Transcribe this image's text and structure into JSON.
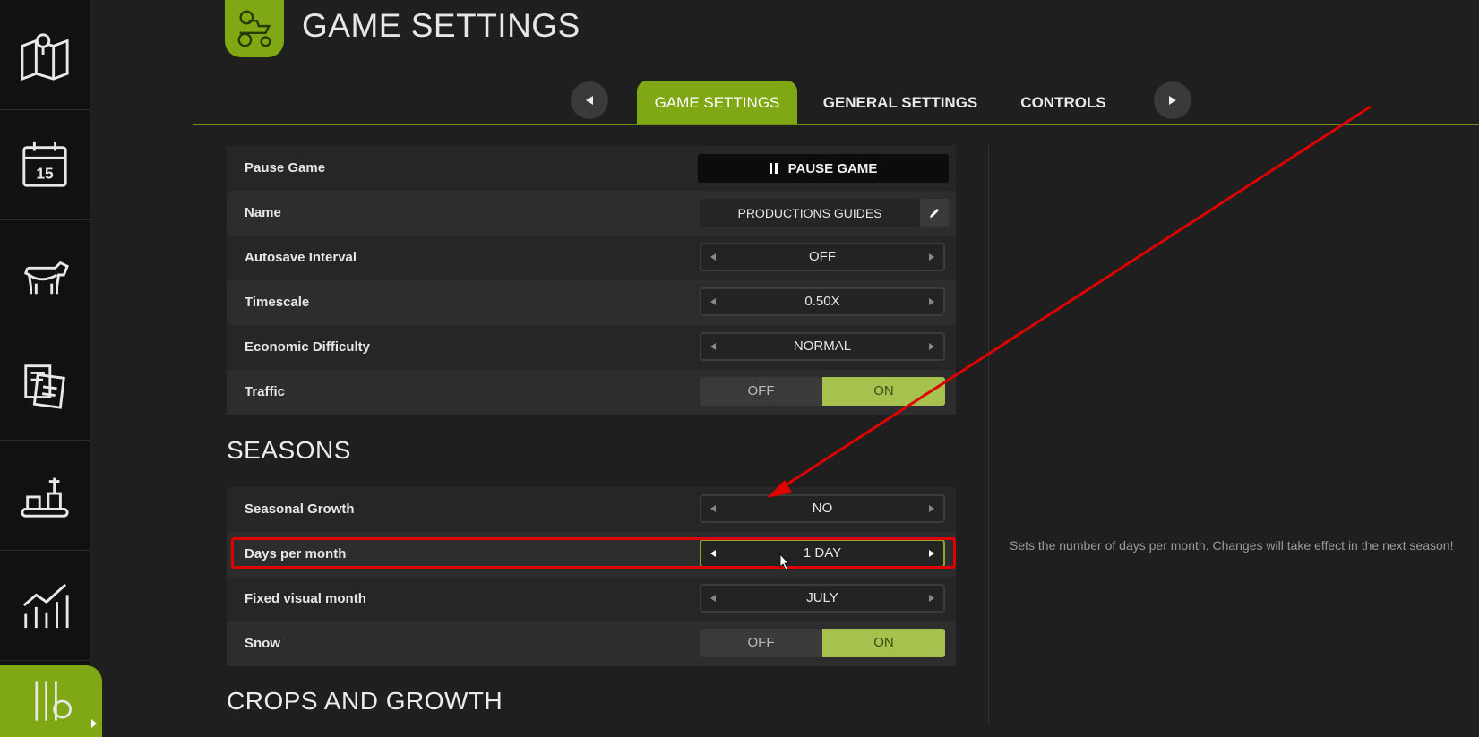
{
  "header": {
    "title": "GAME SETTINGS"
  },
  "tabs": [
    {
      "label": "GAME SETTINGS",
      "active": true
    },
    {
      "label": "GENERAL SETTINGS",
      "active": false
    },
    {
      "label": "CONTROLS",
      "active": false
    }
  ],
  "sidebar": {
    "items": [
      {
        "icon": "map-icon"
      },
      {
        "icon": "calendar-icon",
        "day": "15"
      },
      {
        "icon": "cow-icon"
      },
      {
        "icon": "contracts-icon"
      },
      {
        "icon": "production-icon"
      },
      {
        "icon": "statistics-icon"
      },
      {
        "icon": "settings-icon",
        "active": true
      }
    ]
  },
  "settings": {
    "pause_game": {
      "label": "Pause Game",
      "button": "PAUSE GAME"
    },
    "name": {
      "label": "Name",
      "value": "PRODUCTIONS GUIDES"
    },
    "autosave": {
      "label": "Autosave Interval",
      "value": "OFF"
    },
    "timescale": {
      "label": "Timescale",
      "value": "0.50X"
    },
    "economic": {
      "label": "Economic Difficulty",
      "value": "NORMAL"
    },
    "traffic": {
      "label": "Traffic",
      "off": "OFF",
      "on": "ON",
      "state": "on"
    }
  },
  "seasons": {
    "title": "SEASONS",
    "seasonal_growth": {
      "label": "Seasonal Growth",
      "value": "NO"
    },
    "days_per_month": {
      "label": "Days per month",
      "value": "1 DAY"
    },
    "fixed_visual_month": {
      "label": "Fixed visual month",
      "value": "JULY"
    },
    "snow": {
      "label": "Snow",
      "off": "OFF",
      "on": "ON",
      "state": "on"
    }
  },
  "crops": {
    "title": "CROPS AND GROWTH"
  },
  "help_text": "Sets the number of days per month. Changes will take effect in the next season!",
  "colors": {
    "accent": "#7fa814",
    "toggle_on": "#a7c14e",
    "annotation": "#e00000"
  }
}
